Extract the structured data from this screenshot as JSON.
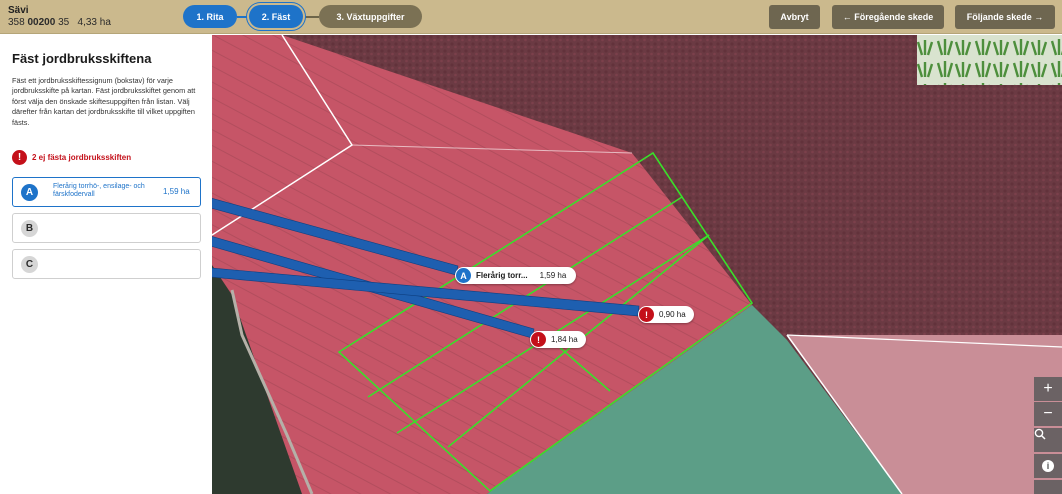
{
  "header": {
    "farm_name": "Sävi",
    "farm_code_prefix": "358",
    "farm_code_bold": "002",
    "farm_code_bold2": "00",
    "farm_code_suffix": "35",
    "farm_area": "4,33 ha",
    "steps": [
      {
        "label": "1. Rita"
      },
      {
        "label": "2. Fäst"
      },
      {
        "label": "3. Växtuppgifter"
      }
    ],
    "cancel_label": "Avbryt",
    "prev_label": "← Föregående skede",
    "next_label": "Följande skede →"
  },
  "panel": {
    "title": "Fäst jordbruksskiftena",
    "instructions": "Fäst ett jordbruksskiftessignum (bokstav) för varje jordbruksskifte på kartan. Fäst jordbruksskiftet genom att först välja den önskade skiftesuppgiften från listan. Välj därefter från kartan det jordbruksskifte till vilket uppgiften fästs.",
    "warning": "2 ej fästa jordbruksskiften",
    "warning_icon": "!",
    "cards": [
      {
        "letter": "A",
        "crop": "Flerårig torrhö-, ensilage- och färskfodervall",
        "area": "1,59 ha"
      },
      {
        "letter": "B"
      },
      {
        "letter": "C"
      }
    ]
  },
  "map": {
    "labels": [
      {
        "letter": "A",
        "crop": "Flerårig torr...",
        "area": "1,59 ha"
      },
      {
        "icon": "!",
        "area": "0,90 ha"
      },
      {
        "icon": "!",
        "area": "1,84 ha"
      }
    ],
    "controls": {
      "zoom_in": "+",
      "zoom_out": "−",
      "search_icon": "search-icon",
      "info": "i"
    },
    "colors": {
      "field_boundary": "#39e02a",
      "selected": "#1e73c9",
      "warning": "#c4101a"
    }
  }
}
